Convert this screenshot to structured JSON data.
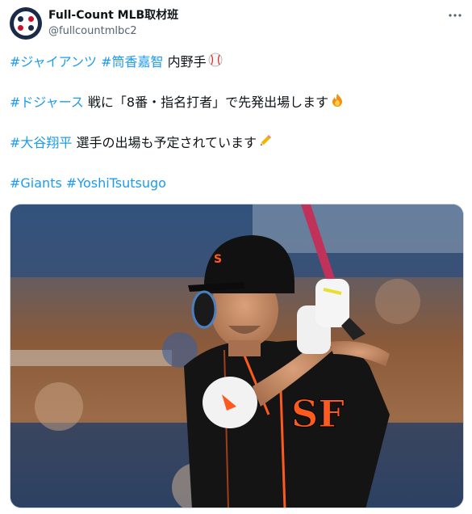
{
  "author": {
    "display_name": "Full-Count MLB取材班",
    "handle": "@fullcountmlbc2"
  },
  "more_icon": "more-horizontal-icon",
  "tweet": {
    "line1": {
      "tag1": "#ジャイアンツ",
      "tag2": "#筒香嘉智",
      "text": " 内野手",
      "emoji": "baseball-icon"
    },
    "line2": {
      "tag": "#ドジャース",
      "text": " 戦に「8番・指名打者」で先発出場します",
      "emoji": "fire-icon"
    },
    "line3": {
      "tag": "#大谷翔平",
      "text": " 選手の出場も予定されています",
      "emoji": "pencil-icon"
    },
    "line4": {
      "tag1": "#Giants",
      "tag2": "#YoshiTsutsugo"
    }
  },
  "colors": {
    "link": "#1d9bf0",
    "text": "#0f1419",
    "secondary": "#536471",
    "giants_orange": "#fd5a1e"
  },
  "media": {
    "type": "photo"
  }
}
